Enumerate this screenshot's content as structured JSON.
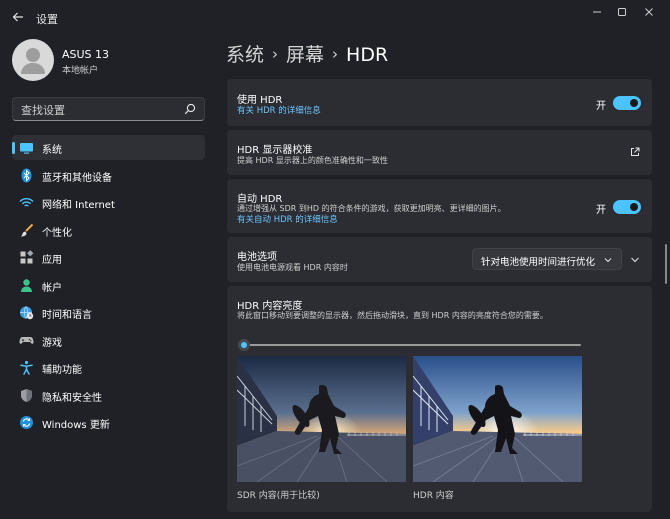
{
  "window": {
    "title": "设置",
    "back_icon": "back-arrow-icon",
    "controls": [
      "minimize-icon",
      "maximize-icon",
      "close-icon"
    ]
  },
  "user": {
    "name": "ASUS 13",
    "account_type": "本地帐户"
  },
  "search": {
    "placeholder": "查找设置",
    "value": ""
  },
  "sidebar": {
    "accent_color": "#4cc2ff",
    "items": [
      {
        "label": "系统",
        "icon": "system-icon",
        "active": true
      },
      {
        "label": "蓝牙和其他设备",
        "icon": "bluetooth-icon"
      },
      {
        "label": "网络和 Internet",
        "icon": "wifi-icon"
      },
      {
        "label": "个性化",
        "icon": "brush-icon"
      },
      {
        "label": "应用",
        "icon": "apps-icon"
      },
      {
        "label": "帐户",
        "icon": "account-icon"
      },
      {
        "label": "时间和语言",
        "icon": "globe-clock-icon"
      },
      {
        "label": "游戏",
        "icon": "gamepad-icon"
      },
      {
        "label": "辅助功能",
        "icon": "accessibility-icon"
      },
      {
        "label": "隐私和安全性",
        "icon": "shield-icon"
      },
      {
        "label": "Windows 更新",
        "icon": "update-icon"
      }
    ]
  },
  "breadcrumb": {
    "parts": [
      "系统",
      "屏幕"
    ],
    "separator": "›",
    "current": "HDR"
  },
  "cards": {
    "use_hdr": {
      "title": "使用 HDR",
      "link": "有关 HDR 的详细信息",
      "toggle_label": "开",
      "toggle_on": true
    },
    "calibration": {
      "title": "HDR 显示器校准",
      "desc": "提高 HDR 显示器上的颜色准确性和一致性",
      "icon": "open-external-icon"
    },
    "auto_hdr": {
      "title": "自动 HDR",
      "desc": "通过增强从 SDR 到HD 的符合条件的游戏，获取更加明亮、更详细的图片。",
      "link": "有关自动 HDR 的详细信息",
      "toggle_label": "开",
      "toggle_on": true
    },
    "battery": {
      "title": "电池选项",
      "desc": "使用电池电源观看 HDR 内容时",
      "dropdown_value": "针对电池使用时间进行优化",
      "expand_icon": "chevron-down-icon"
    },
    "brightness": {
      "title": "HDR 内容亮度",
      "desc": "将此窗口移动到要调整的显示器，然后拖动滑块，直到 HDR 内容的亮度符合您的需要。",
      "slider_value": 0,
      "sdr_caption": "SDR 内容(用于比较)",
      "hdr_caption": "HDR 内容"
    }
  }
}
